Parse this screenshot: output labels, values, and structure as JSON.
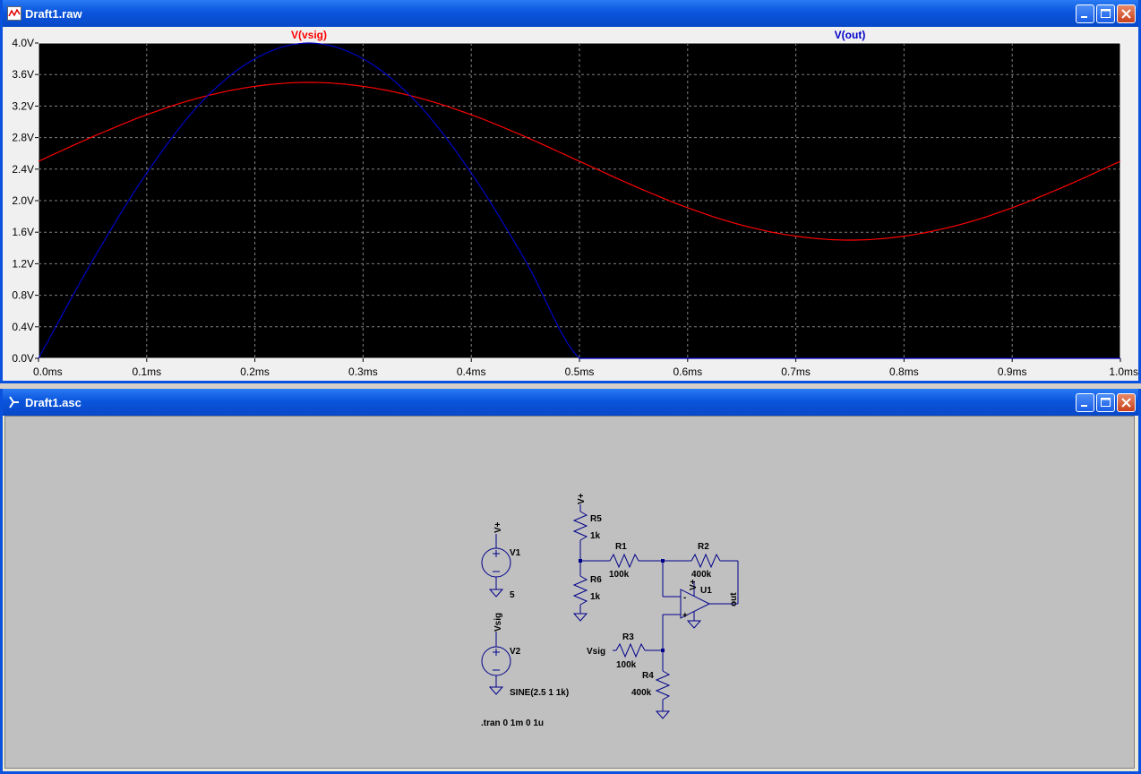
{
  "plot_window": {
    "title": "Draft1.raw"
  },
  "schematic_window": {
    "title": "Draft1.asc"
  },
  "chart_data": {
    "type": "line",
    "x_ticks": [
      "0.0ms",
      "0.1ms",
      "0.2ms",
      "0.3ms",
      "0.4ms",
      "0.5ms",
      "0.6ms",
      "0.7ms",
      "0.8ms",
      "0.9ms",
      "1.0ms"
    ],
    "y_ticks": [
      "0.0V",
      "0.4V",
      "0.8V",
      "1.2V",
      "1.6V",
      "2.0V",
      "2.4V",
      "2.8V",
      "3.2V",
      "3.6V",
      "4.0V"
    ],
    "xlim": [
      0,
      1.0
    ],
    "ylim": [
      0,
      4.0
    ],
    "grid": true,
    "background": "#000000",
    "series": [
      {
        "name": "V(vsig)",
        "color": "#ff0000",
        "x": [
          0,
          0.05,
          0.1,
          0.15,
          0.2,
          0.25,
          0.3,
          0.35,
          0.4,
          0.45,
          0.5,
          0.55,
          0.6,
          0.65,
          0.7,
          0.75,
          0.8,
          0.85,
          0.9,
          0.95,
          1.0
        ],
        "y": [
          2.5,
          2.81,
          3.09,
          3.31,
          3.45,
          3.5,
          3.45,
          3.31,
          3.09,
          2.81,
          2.5,
          2.19,
          1.91,
          1.69,
          1.55,
          1.5,
          1.55,
          1.69,
          1.91,
          2.19,
          2.5
        ]
      },
      {
        "name": "V(out)",
        "color": "#0000c8",
        "x": [
          0,
          0.05,
          0.1,
          0.15,
          0.2,
          0.25,
          0.3,
          0.35,
          0.4,
          0.45,
          0.5,
          0.55,
          0.6,
          0.65,
          0.7,
          0.75,
          0.8,
          0.85,
          0.9,
          0.95,
          1.0
        ],
        "y": [
          0.0,
          1.24,
          2.35,
          3.24,
          3.8,
          4.0,
          3.8,
          3.24,
          2.35,
          1.24,
          0.0,
          0.0,
          0.0,
          0.0,
          0.0,
          0.0,
          0.0,
          0.0,
          0.0,
          0.0,
          0.0
        ]
      }
    ]
  },
  "schematic": {
    "labels": {
      "v1_net": "V+",
      "v1_name": "V1",
      "v1_value": "5",
      "v2_net": "Vsig",
      "v2_name": "V2",
      "v2_value": "SINE(2.5 1 1k)",
      "tran": ".tran 0 1m 0 1u",
      "r5_net": "V+",
      "r5_name": "R5",
      "r5_value": "1k",
      "r6_name": "R6",
      "r6_value": "1k",
      "r1_name": "R1",
      "r1_value": "100k",
      "r2_name": "R2",
      "r2_value": "400k",
      "u1_net": "V+",
      "u1_name": "U1",
      "out_label": "out",
      "r3_net": "Vsig",
      "r3_name": "R3",
      "r3_value": "100k",
      "r4_name": "R4",
      "r4_value": "400k",
      "plus_sign": "+",
      "minus_sign": "-"
    },
    "wire_color": "#00008b",
    "label_color": "#000000"
  }
}
